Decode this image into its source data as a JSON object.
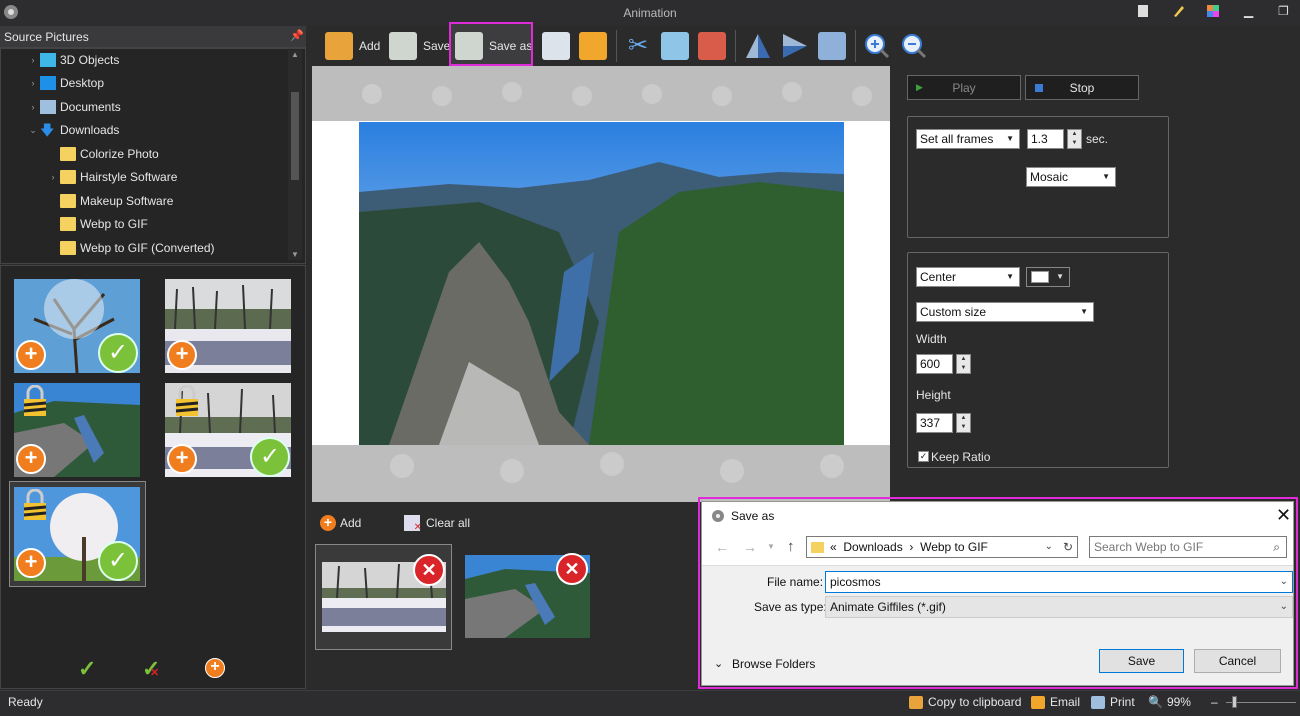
{
  "window": {
    "title": "Animation"
  },
  "left": {
    "header": "Source Pictures",
    "tree": [
      {
        "label": "3D Objects",
        "icon": "3d-objects-icon",
        "color": "#3fb6e8"
      },
      {
        "label": "Desktop",
        "icon": "desktop-icon",
        "color": "#1e90e8"
      },
      {
        "label": "Documents",
        "icon": "documents-icon",
        "color": "#9fbfdf"
      },
      {
        "label": "Downloads",
        "icon": "downloads-icon",
        "color": "#2b8de8"
      },
      {
        "label": "Colorize Photo",
        "icon": "folder-icon"
      },
      {
        "label": "Hairstyle Software",
        "icon": "folder-icon"
      },
      {
        "label": "Makeup Software",
        "icon": "folder-icon"
      },
      {
        "label": "Webp to GIF",
        "icon": "folder-icon"
      },
      {
        "label": "Webp to GIF (Converted)",
        "icon": "folder-icon"
      }
    ]
  },
  "toolbar": {
    "add": "Add",
    "save": "Save",
    "save_as": "Save as"
  },
  "props": {
    "play": "Play",
    "stop": "Stop",
    "frames_mode": "Set all frames",
    "duration": "1.3",
    "duration_unit": "sec.",
    "transition": "Mosaic",
    "align": "Center",
    "size_mode": "Custom size",
    "width_label": "Width",
    "width": "600",
    "height_label": "Height",
    "height": "337",
    "keep_ratio": "Keep Ratio"
  },
  "frames": {
    "add": "Add",
    "clear_all": "Clear all"
  },
  "dialog": {
    "title": "Save as",
    "path_prefix": "«",
    "path_1": "Downloads",
    "path_2": "Webp to GIF",
    "search_placeholder": "Search Webp to GIF",
    "file_name_label": "File name:",
    "file_name": "picosmos",
    "save_type_label": "Save as type:",
    "save_type": "Animate Giffiles (*.gif)",
    "browse_folders": "Browse Folders",
    "save": "Save",
    "cancel": "Cancel"
  },
  "status": {
    "text": "Ready",
    "copy": "Copy to clipboard",
    "email": "Email",
    "print": "Print",
    "zoom": "99%"
  },
  "colors": {
    "accent_highlight": "#e02bd9",
    "plus_orange": "#f07d1e",
    "check_green": "#7cc13a",
    "delete_red": "#d9252a"
  }
}
